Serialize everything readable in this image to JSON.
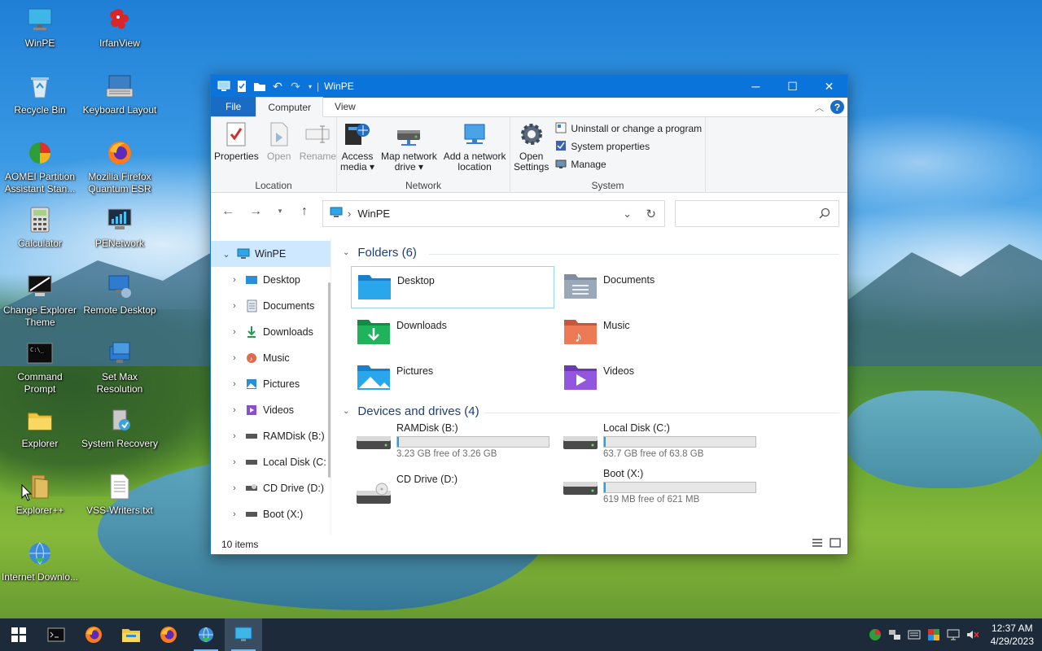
{
  "desktop": {
    "icons": [
      {
        "label": "WinPE"
      },
      {
        "label": "IrfanView"
      },
      {
        "label": "Recycle Bin"
      },
      {
        "label": "Keyboard Layout"
      },
      {
        "label": "AOMEI Partition Assistant Stan..."
      },
      {
        "label": "Mozilla Firefox Quantum ESR"
      },
      {
        "label": "Calculator"
      },
      {
        "label": "PENetwork"
      },
      {
        "label": "Change Explorer Theme"
      },
      {
        "label": "Remote Desktop"
      },
      {
        "label": "Command Prompt"
      },
      {
        "label": "Set Max Resolution"
      },
      {
        "label": "Explorer"
      },
      {
        "label": "System Recovery"
      },
      {
        "label": "Explorer++"
      },
      {
        "label": "VSS-Writers.txt"
      },
      {
        "label": "Internet Downlo..."
      }
    ]
  },
  "window": {
    "title": "WinPE",
    "ribbon_tabs": [
      "File",
      "Computer",
      "View"
    ],
    "active_tab": "Computer",
    "ribbon": {
      "location": {
        "label": "Location",
        "buttons": [
          "Properties",
          "Open",
          "Rename"
        ]
      },
      "network": {
        "label": "Network",
        "access_media": [
          "Access",
          "media ▾"
        ],
        "map_drive": [
          "Map network",
          "drive ▾"
        ],
        "add_location": [
          "Add a network",
          "location"
        ]
      },
      "system": {
        "label": "System",
        "open_settings": [
          "Open",
          "Settings"
        ],
        "uninstall": "Uninstall or change a program",
        "sys_props": "System properties",
        "manage": "Manage"
      }
    },
    "address": {
      "path": "WinPE",
      "search_placeholder": ""
    },
    "nav_pane": [
      {
        "label": "WinPE",
        "icon": "computer-icon"
      },
      {
        "label": "Desktop",
        "icon": "desktop-folder-icon"
      },
      {
        "label": "Documents",
        "icon": "documents-icon"
      },
      {
        "label": "Downloads",
        "icon": "downloads-icon"
      },
      {
        "label": "Music",
        "icon": "music-icon"
      },
      {
        "label": "Pictures",
        "icon": "pictures-icon"
      },
      {
        "label": "Videos",
        "icon": "videos-icon"
      },
      {
        "label": "RAMDisk (B:)",
        "icon": "drive-icon"
      },
      {
        "label": "Local Disk (C:",
        "icon": "drive-icon"
      },
      {
        "label": "CD Drive (D:)",
        "icon": "cd-drive-icon"
      },
      {
        "label": "Boot (X:)",
        "icon": "drive-icon"
      }
    ],
    "folders_header": "Folders (6)",
    "folders": [
      {
        "name": "Desktop"
      },
      {
        "name": "Documents"
      },
      {
        "name": "Downloads"
      },
      {
        "name": "Music"
      },
      {
        "name": "Pictures"
      },
      {
        "name": "Videos"
      }
    ],
    "drives_header": "Devices and drives (4)",
    "drives": [
      {
        "name": "RAMDisk (B:)",
        "free": "3.23 GB free of 3.26 GB",
        "used_fraction": 0.01
      },
      {
        "name": "Local Disk (C:)",
        "free": "63.7 GB free of 63.8 GB",
        "used_fraction": 0.002
      },
      {
        "name": "CD Drive (D:)"
      },
      {
        "name": "Boot (X:)",
        "free": "619 MB free of 621 MB",
        "used_fraction": 0.003
      }
    ],
    "status": "10 items"
  },
  "taskbar": {
    "clock_time": "12:37 AM",
    "clock_date": "4/29/2023"
  },
  "colors": {
    "titlebar": "#0a74da",
    "file_tab": "#1a6bc4",
    "taskbar": "#1c2a3a",
    "selection": "#cde8ff"
  }
}
